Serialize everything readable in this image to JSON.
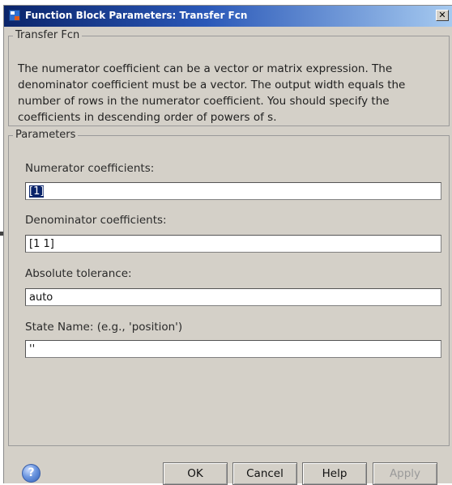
{
  "window": {
    "title": "Function Block Parameters: Transfer Fcn",
    "close_glyph": "✕"
  },
  "block": {
    "group_label": "Transfer Fcn",
    "description": "The numerator coefficient can be a vector or matrix expression. The denominator coefficient must be a vector. The output width equals the number of rows in the numerator coefficient. You should specify the coefficients in descending order of powers of s."
  },
  "parameters": {
    "group_label": "Parameters",
    "fields": [
      {
        "label": "Numerator coefficients:",
        "value": "[1]"
      },
      {
        "label": "Denominator coefficients:",
        "value": "[1 1]"
      },
      {
        "label": "Absolute tolerance:",
        "value": "auto"
      },
      {
        "label": "State Name: (e.g., 'position')",
        "value": "''"
      }
    ]
  },
  "buttons": {
    "help_glyph": "?",
    "ok": "OK",
    "cancel": "Cancel",
    "help": "Help",
    "apply": "Apply"
  },
  "icons": {
    "app": "simulink-block-icon",
    "help": "help-circle-icon",
    "close": "close-icon"
  }
}
